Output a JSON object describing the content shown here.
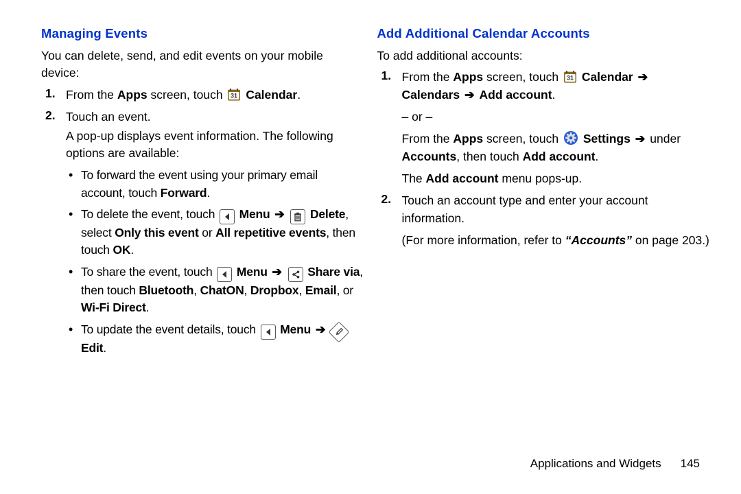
{
  "left": {
    "heading": "Managing Events",
    "intro": "You can delete, send, and edit events on your mobile device:",
    "steps": [
      {
        "num": "1.",
        "pre": "From the ",
        "apps": "Apps",
        "mid": " screen, touch ",
        "calendar": "Calendar",
        "post": "."
      },
      {
        "num": "2.",
        "line1": "Touch an event.",
        "line2": "A pop-up displays event information. The following options are available:",
        "bullets": [
          {
            "pre": "To forward the event using your primary email account, touch ",
            "b1": "Forward",
            "post": "."
          },
          {
            "pre": "To delete the event, touch ",
            "menu": "Menu",
            "arrow1": "➔",
            "delete": "Delete",
            "mid": ", select ",
            "only": "Only this event",
            "or": " or ",
            "all": "All repetitive events",
            "then": ", then touch ",
            "ok": "OK",
            "post": "."
          },
          {
            "pre": "To share the event, touch ",
            "menu": "Menu",
            "arrow1": "➔",
            "share": "Share via",
            "mid": ", then touch ",
            "bt": "Bluetooth",
            "c1": ", ",
            "chaton": "ChatON",
            "c2": ", ",
            "dropbox": "Dropbox",
            "c3": ", ",
            "email": "Email",
            "or": ", or ",
            "wifi": "Wi-Fi Direct",
            "post": "."
          },
          {
            "pre": "To update the event details, touch ",
            "menu": "Menu",
            "arrow1": "➔",
            "edit": "Edit",
            "post": "."
          }
        ]
      }
    ]
  },
  "right": {
    "heading": "Add Additional Calendar Accounts",
    "intro": "To add additional accounts:",
    "steps": [
      {
        "num": "1.",
        "l1_pre": "From the ",
        "l1_apps": "Apps",
        "l1_mid": " screen, touch ",
        "l1_cal": "Calendar",
        "l1_arrow1": "➔",
        "l1_calendars": "Calendars",
        "l1_arrow2": "➔",
        "l1_add": "Add account",
        "l1_post": ".",
        "or": "– or –",
        "l2_pre": "From the ",
        "l2_apps": "Apps",
        "l2_mid": " screen, touch ",
        "l2_settings": "Settings",
        "l2_arrow1": "➔",
        "l2_under": " under ",
        "l2_accounts": "Accounts",
        "l2_then": ", then touch ",
        "l2_add": "Add account",
        "l2_post": ".",
        "l3_pre": "The ",
        "l3_add": "Add account",
        "l3_post": " menu pops-up."
      },
      {
        "num": "2.",
        "l1": "Touch an account type and enter your account information.",
        "l2_pre": "(For more information, refer to ",
        "l2_ref": "“Accounts”",
        "l2_post": " on page 203.)"
      }
    ]
  },
  "footer": {
    "section": "Applications and Widgets",
    "page": "145"
  }
}
